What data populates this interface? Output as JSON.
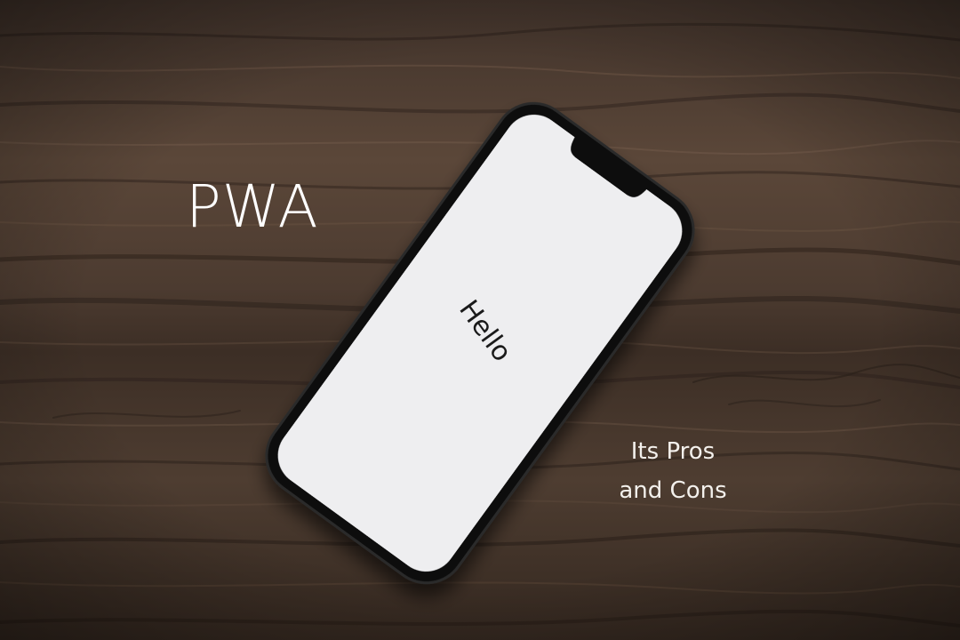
{
  "heading": {
    "title": "PWA",
    "subtitle_line1": "Its Pros",
    "subtitle_line2": "and Cons"
  },
  "phone": {
    "screen_text": "Hello",
    "icon": "smartphone-icon"
  },
  "colors": {
    "wood_dark": "#3a2c23",
    "wood_mid": "#5a4638",
    "wood_light": "#6e5747",
    "phone_body": "#111111",
    "phone_screen": "#eeeef0",
    "text_white": "#ffffff"
  }
}
